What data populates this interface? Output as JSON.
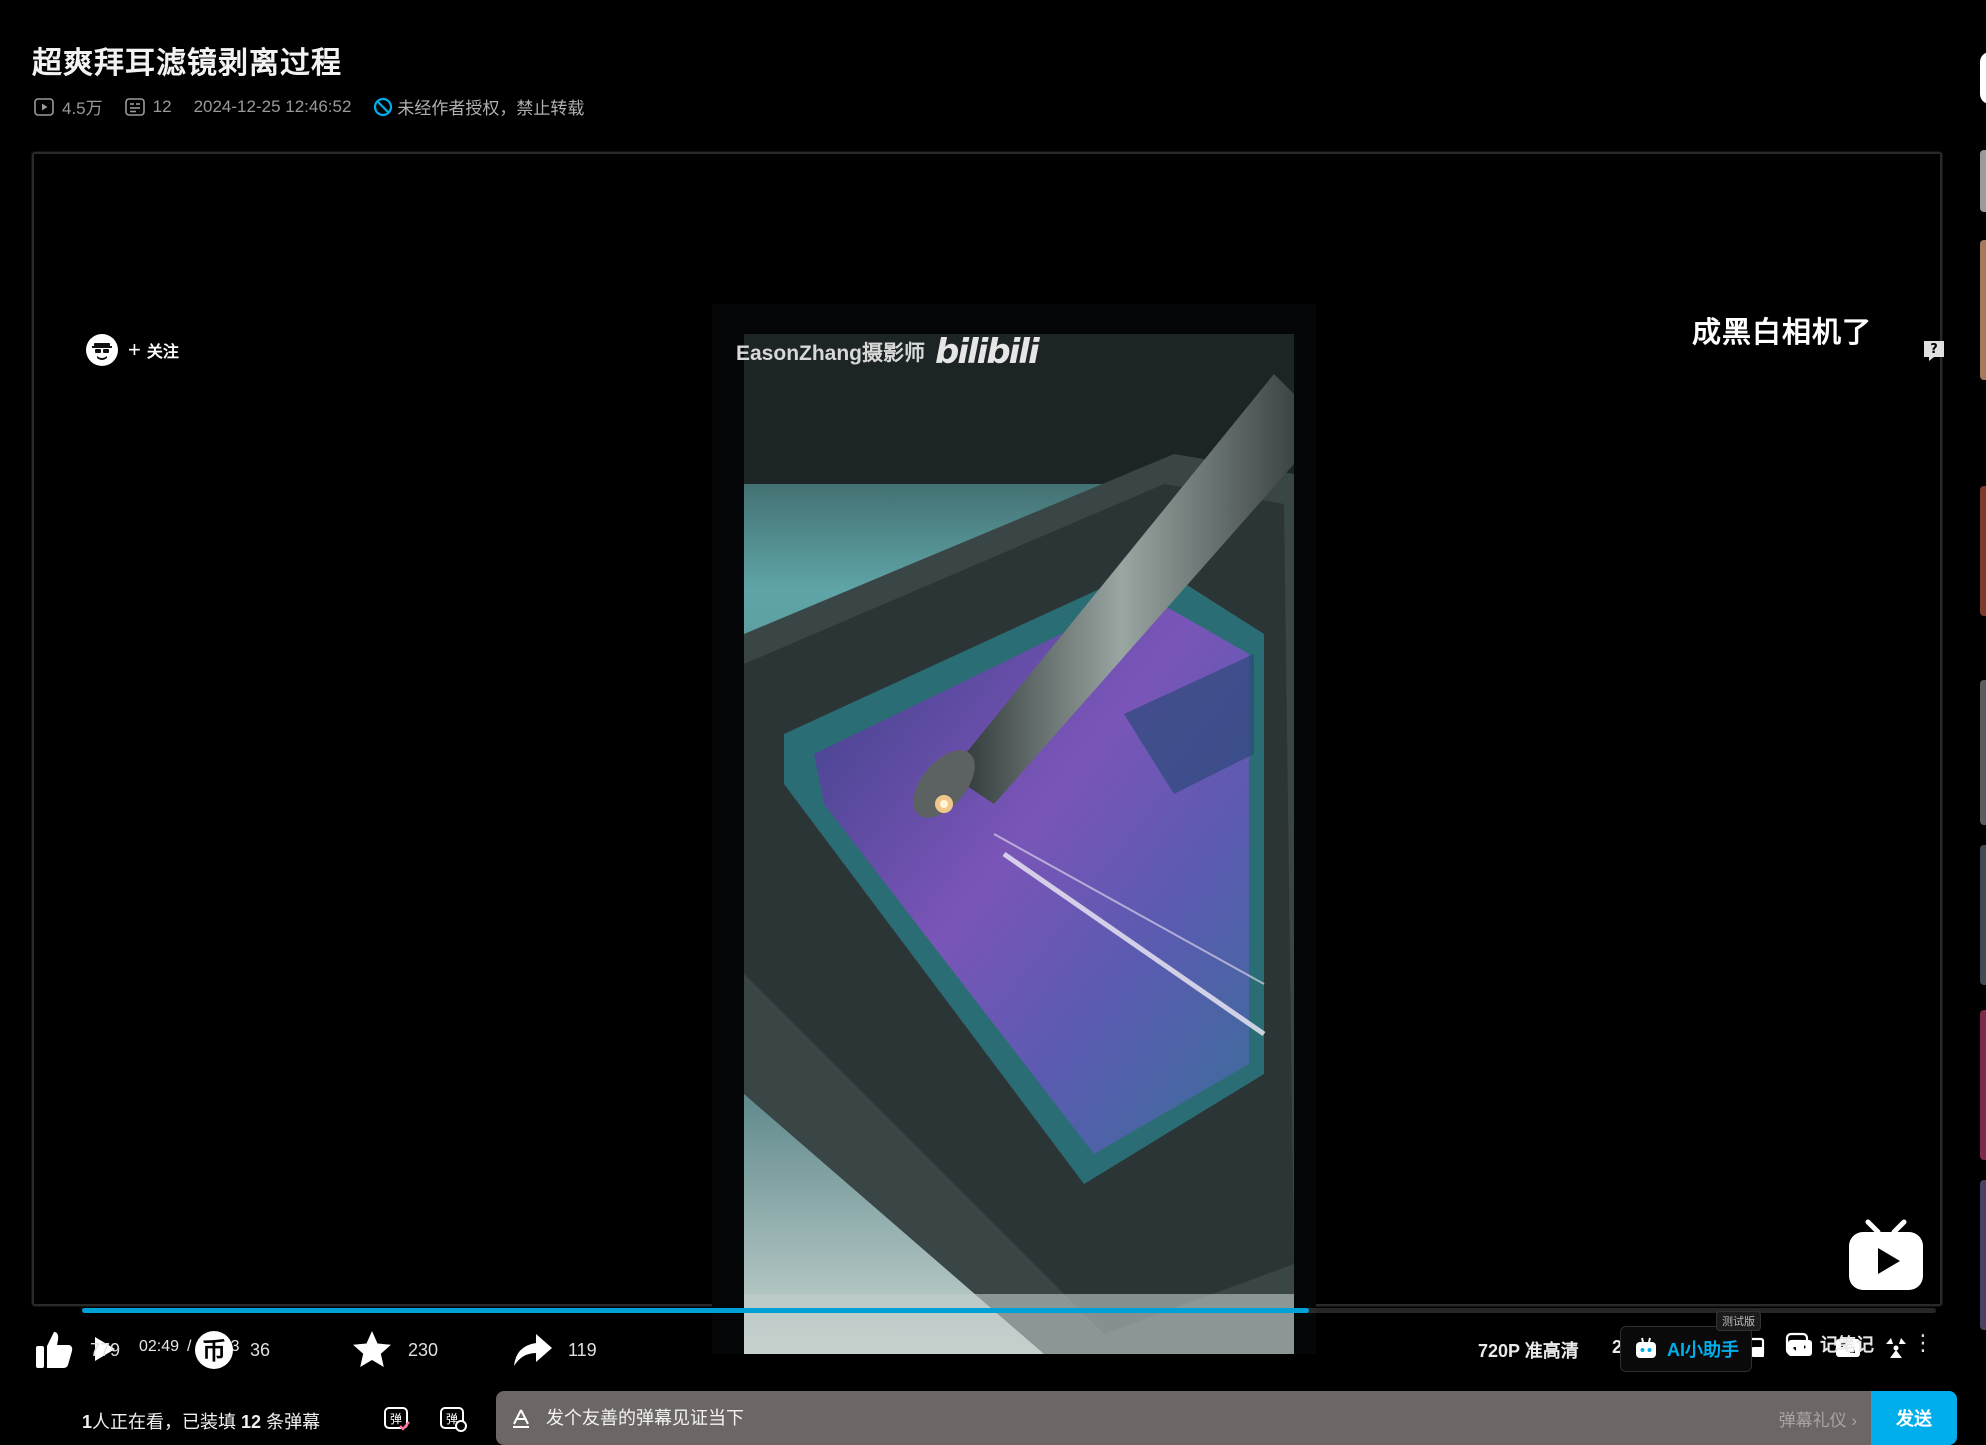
{
  "video": {
    "title": "超爽拜耳滤镜剥离过程",
    "views": "4.5万",
    "danmaku_count": "12",
    "publish_time": "2024-12-25 12:46:52",
    "copyright_notice": "未经作者授权，禁止转载"
  },
  "player": {
    "uploader_follow_label": "关注",
    "watermark_text": "EasonZhang摄影师",
    "watermark_logo": "bilibili",
    "danmaku_overlay_text": "成黑白相机了",
    "progress_fraction": 0.662,
    "current_time": "02:49",
    "time_separator": "/",
    "duration": "03:23",
    "quality_label": "720P 准高清",
    "speed_label": "2.0x",
    "icons": [
      "play-icon",
      "volume-icon",
      "settings-icon",
      "pip-icon",
      "widescreen-icon",
      "web-fullscreen-icon",
      "fullscreen-icon"
    ]
  },
  "danmaku_bar": {
    "viewers_count": "1",
    "viewers_text": "人正在看，已装填",
    "loaded_count": "12",
    "loaded_suffix": "条弹幕",
    "input_placeholder": "发个友善的弹幕见证当下",
    "etiquette_label": "弹幕礼仪 ›",
    "send_label": "发送"
  },
  "actions": {
    "like_count": "779",
    "coin_count": "36",
    "favorite_count": "230",
    "share_count": "119",
    "ai_beta_badge": "测试版",
    "ai_label": "AI小助手",
    "note_label": "记笔记"
  },
  "colors": {
    "accent": "#00a1d6",
    "send_button": "#00aeec",
    "background": "#000000"
  }
}
